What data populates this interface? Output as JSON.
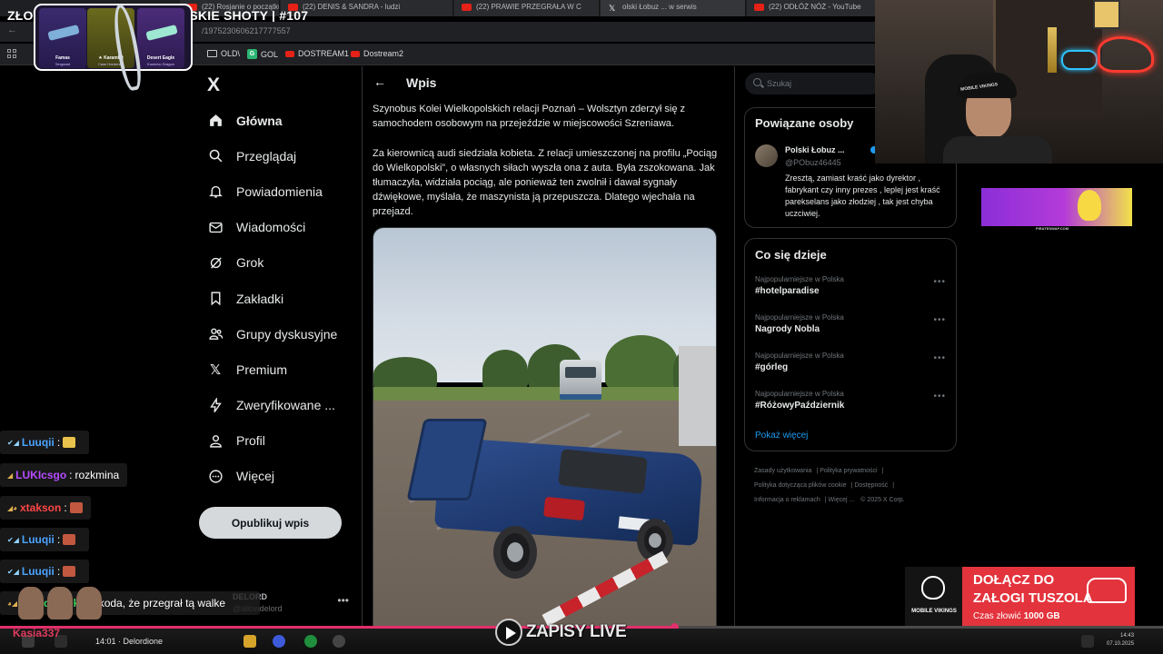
{
  "browser": {
    "title_line": "ZŁOT NY MOMENTS 😂 | POLSKIE SHOTY | #107",
    "tabs": [
      {
        "label": "(22) Rosjanie o początku woj",
        "icon": "youtube-icon"
      },
      {
        "label": "(22) DENIS & SANDRA - ludzi",
        "icon": "youtube-icon"
      },
      {
        "label": "(22) PRAWIE PRZEGRAŁA W C",
        "icon": "youtube-icon"
      },
      {
        "label": "olski Łobuz ... w serwis",
        "icon": "x-icon"
      },
      {
        "label": "(22) ODŁÓŻ NÓŻ - YouTube",
        "icon": "youtube-icon"
      }
    ],
    "url": "/1975230606217777557",
    "bookmarks": [
      {
        "label": "OLD\\",
        "icon": "folder-icon"
      },
      {
        "label": "GOL",
        "icon": "gol-icon"
      },
      {
        "label": "DOSTREAM1",
        "icon": "youtube-icon"
      },
      {
        "label": "Dostream2",
        "icon": "youtube-icon"
      }
    ]
  },
  "items_overlay": {
    "cards": [
      {
        "name": "Famas",
        "skin": "Sergeant"
      },
      {
        "name": "★ Karambit",
        "skin": "Case Hardened"
      },
      {
        "name": "Desert Eagle",
        "skin": "Kumicho Dragon"
      }
    ]
  },
  "x_nav": {
    "logo": "X",
    "items": [
      {
        "label": "Główna",
        "icon": "home-icon",
        "bold": true
      },
      {
        "label": "Przeglądaj",
        "icon": "search-icon",
        "bold": false
      },
      {
        "label": "Powiadomienia",
        "icon": "bell-icon",
        "bold": false
      },
      {
        "label": "Wiadomości",
        "icon": "mail-icon",
        "bold": false
      },
      {
        "label": "Grok",
        "icon": "grok-icon",
        "bold": false
      },
      {
        "label": "Zakładki",
        "icon": "bookmark-icon",
        "bold": false
      },
      {
        "label": "Grupy dyskusyjne",
        "icon": "communities-icon",
        "bold": false
      },
      {
        "label": "Premium",
        "icon": "x-premium-icon",
        "bold": false
      },
      {
        "label": "Zweryfikowane ...",
        "icon": "lightning-icon",
        "bold": false
      },
      {
        "label": "Profil",
        "icon": "person-icon",
        "bold": false
      },
      {
        "label": "Więcej",
        "icon": "more-circle-icon",
        "bold": false
      }
    ],
    "post_button": "Opublikuj wpis",
    "account": {
      "name": "DELORD",
      "handle": "@allowdelord"
    }
  },
  "post": {
    "header_title": "Wpis",
    "paragraph1": "Szynobus Kolei Wielkopolskich relacji Poznań – Wolsztyn zderzył się z samochodem osobowym na przejeździe w miejscowości Szreniawa.",
    "paragraph2": "Za kierownicą audi siedziała kobieta. Z relacji umieszczonej na profilu „Pociąg do Wielkopolski”, o własnych siłach wyszła ona z auta. Była zszokowana. Jak tłumaczyła, widziała pociąg, ale ponieważ ten zwolnił i dawał sygnały dźwiękowe, myślała, że maszynista ją przepuszcza. Dlatego wjechała na przejazd."
  },
  "right": {
    "search_placeholder": "Szukaj",
    "related_title": "Powiązane osoby",
    "related_person": {
      "name": "Polski Łobuz ...",
      "handle": "@PObuz46445",
      "bio": "Zresztą, zamiast kraść jako dyrektor , fabrykant czy inny prezes , leplej jest kraść parekselans jako złodziej , tak jest chyba uczciwiej."
    },
    "trends_title": "Co się dzieje",
    "trends": [
      {
        "category": "Najpopularniejsze w Polska",
        "name": "#hotelparadise"
      },
      {
        "category": "Najpopularniejsze w Polska",
        "name": "Nagrody Nobla"
      },
      {
        "category": "Najpopularniejsze w Polska",
        "name": "#górleg"
      },
      {
        "category": "Najpopularniejsze w Polska",
        "name": "#RóżowyPaździernik"
      }
    ],
    "show_more": "Pokaż więcej",
    "footer_links": [
      "Zasady użytkowania",
      "Polityka prywatności",
      "Polityka dotycząca plików cookie",
      "Dostępność",
      "Informacja o reklamach",
      "Więcej ...",
      "© 2025 X Corp."
    ]
  },
  "webcam": {
    "cap_text": "MOBILE VIKINGS"
  },
  "ad_caption": "PIRATESWAP.COM",
  "chat": [
    {
      "user": "Luuqii",
      "text": "",
      "user_color": "#4aa3ff",
      "emote_color": "#e8c24a"
    },
    {
      "user": "LUKIcsgo",
      "text": "rozkmina",
      "user_color": "#b64cff",
      "emote_color": ""
    },
    {
      "user": "xtakson",
      "text": "",
      "user_color": "#ff4646",
      "emote_color": "#c2583f"
    },
    {
      "user": "Luuqii",
      "text": "",
      "user_color": "#4aa3ff",
      "emote_color": "#c2583f"
    },
    {
      "user": "Luuqii",
      "text": "",
      "user_color": "#4aa3ff",
      "emote_color": "#c2583f"
    },
    {
      "user": "cwl_doreek",
      "text": "szkoda, że przegrał tą walke",
      "user_color": "#3fd35a",
      "emote_color": ""
    }
  ],
  "mobile_vikings_ad": {
    "brand": "MOBILE VIKINGS",
    "headline1": "DOŁĄCZ DO",
    "headline2": "ZAŁOGI TUSZOLA",
    "sub_prefix": "Czas złowić",
    "sub_bold": "1000 GB"
  },
  "player": {
    "time": "14:01 · Delordione",
    "progress_fraction": 0.58,
    "watermark": "ZAPISY LIVE",
    "clock": "14:43",
    "date": "07.10.2025"
  },
  "team_overlay": {
    "name": "Kasia337"
  }
}
